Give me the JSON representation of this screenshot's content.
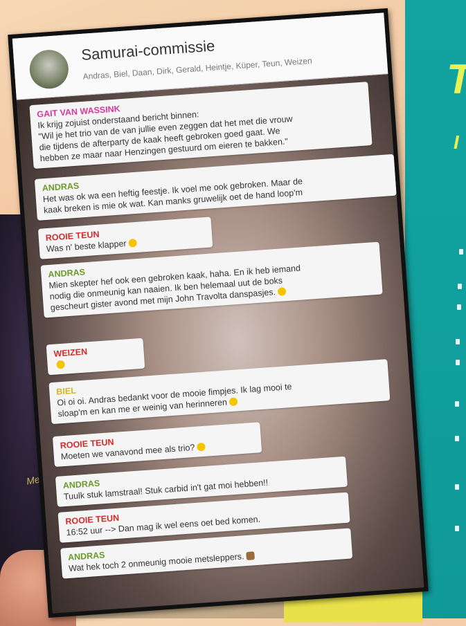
{
  "chat": {
    "title": "Samurai-commissie",
    "members": "Andras, Biel, Daan, Dirk, Gerald, Heintje, Küper, Teun, Weizen"
  },
  "messages": [
    {
      "sender": "GAIT VAN WASSINK",
      "color": "#d63b9c",
      "lines": [
        "Ik krijg zojuist onderstaand bericht binnen:",
        "\"Wil je het trio van de van jullie even zeggen dat het met die vrouw",
        "die tijdens de afterparty de kaak heeft gebroken goed gaat. We",
        "hebben ze maar naar Henzingen gestuurd om eieren te bakken.\""
      ]
    },
    {
      "sender": "ANDRAS",
      "color": "#6c9a2b",
      "lines": [
        "Het was ok wa een heftig feestje. Ik voel me ook gebroken. Maar de",
        "kaak breken is mie ok wat. Kan manks gruwelijk oet de hand loop'm"
      ]
    },
    {
      "sender": "ROOIE TEUN",
      "color": "#d42b2b",
      "lines": [
        "Was n' beste klapper"
      ],
      "emoji": "laughing-emoji"
    },
    {
      "sender": "ANDRAS",
      "color": "#6c9a2b",
      "lines": [
        "Mien skepter hef ook een gebroken kaak, haha.  En ik heb iemand",
        "nodig die onmeunig kan naaien. Ik ben helemaal uut de boks",
        "gescheurt gister avond met mijn John Travolta danspasjes."
      ],
      "emoji": "laughing-emoji"
    },
    {
      "sender": "WEIZEN",
      "color": "#d42b2b",
      "lines": [
        ""
      ],
      "emoji": "tears-of-joy-emoji"
    },
    {
      "sender": "BIEL",
      "color": "#d8b220",
      "lines": [
        "Oi oi oi. Andras bedankt voor de mooie fimpjes. Ik lag mooi te",
        "sloap'm en kan me er weinig van herinneren"
      ],
      "emoji": "grin-emoji"
    },
    {
      "sender": "ROOIE TEUN",
      "color": "#d42b2b",
      "lines": [
        "Moeten we vanavond mee als trio?"
      ],
      "emoji": "thinking-emoji"
    },
    {
      "sender": "ANDRAS",
      "color": "#6c9a2b",
      "lines": [
        "Tuulk stuk lamstraal! Stuk carbid in't gat moi hebben!!"
      ]
    },
    {
      "sender": "ROOIE TEUN",
      "color": "#d42b2b",
      "lines": [
        "16:52 uur --> Dan mag ik wel eens oet bed komen."
      ]
    },
    {
      "sender": "ANDRAS",
      "color": "#6c9a2b",
      "lines": [
        "Wat hek toch 2 onmeunig mooie metsleppers."
      ],
      "emoji": "see-no-evil-monkey-emoji"
    }
  ],
  "background": {
    "robe_text": "Metsl",
    "accent_teal": "#13a4a1",
    "accent_yellow": "#e9f255"
  }
}
